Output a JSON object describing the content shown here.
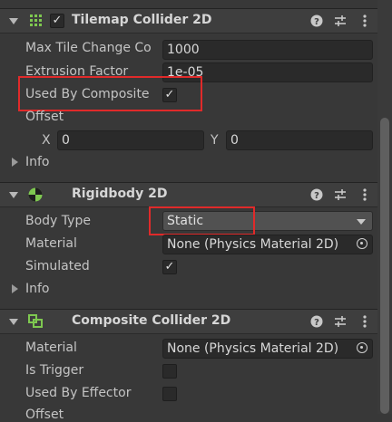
{
  "tilemap_collider": {
    "title": "Tilemap Collider 2D",
    "max_tile_change_label": "Max Tile Change Co",
    "max_tile_change_value": "1000",
    "extrusion_label": "Extrusion Factor",
    "extrusion_value": "1e-05",
    "used_by_composite_label": "Used By Composite",
    "used_by_composite_checked": true,
    "offset_label": "Offset",
    "offset_x_label": "X",
    "offset_x_value": "0",
    "offset_y_label": "Y",
    "offset_y_value": "0",
    "info_label": "Info"
  },
  "rigidbody": {
    "title": "Rigidbody 2D",
    "body_type_label": "Body Type",
    "body_type_value": "Static",
    "material_label": "Material",
    "material_value": "None (Physics Material 2D)",
    "simulated_label": "Simulated",
    "simulated_checked": true,
    "info_label": "Info"
  },
  "composite_collider": {
    "title": "Composite Collider 2D",
    "material_label": "Material",
    "material_value": "None (Physics Material 2D)",
    "is_trigger_label": "Is Trigger",
    "used_by_effector_label": "Used By Effector",
    "offset_label": "Offset"
  },
  "colors": {
    "highlight": "#e02a2a",
    "rigidbody_icon": "#7ec850",
    "composite_icon": "#7ec850"
  }
}
